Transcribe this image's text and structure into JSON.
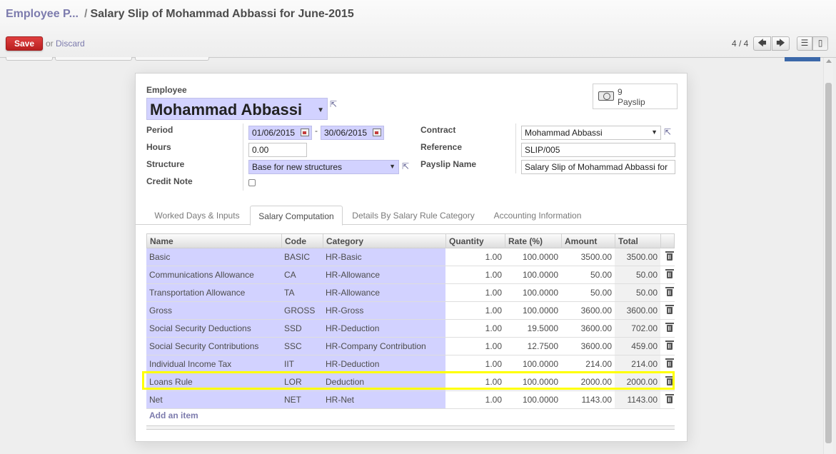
{
  "breadcrumb": {
    "parent": "Employee P...",
    "separator": "/",
    "current": "Salary Slip of Mohammad Abbassi for June-2015"
  },
  "toolbar": {
    "save_label": "Save",
    "or_text": "or",
    "discard_label": "Discard"
  },
  "pager": {
    "text": "4 / 4"
  },
  "smart_button": {
    "count": "9",
    "label": "Payslip"
  },
  "form": {
    "employee_label": "Employee",
    "employee_value": "Mohammad Abbassi",
    "period_label": "Period",
    "period_from": "01/06/2015",
    "period_separator": "-",
    "period_to": "30/06/2015",
    "hours_label": "Hours",
    "hours_value": "0.00",
    "structure_label": "Structure",
    "structure_value": "Base for new structures",
    "credit_note_label": "Credit Note",
    "credit_note_checked": false,
    "contract_label": "Contract",
    "contract_value": "Mohammad Abbassi",
    "reference_label": "Reference",
    "reference_value": "SLIP/005",
    "payslip_name_label": "Payslip Name",
    "payslip_name_value": "Salary Slip of Mohammad Abbassi for"
  },
  "tabs": [
    {
      "label": "Worked Days & Inputs",
      "active": false
    },
    {
      "label": "Salary Computation",
      "active": true
    },
    {
      "label": "Details By Salary Rule Category",
      "active": false
    },
    {
      "label": "Accounting Information",
      "active": false
    }
  ],
  "table": {
    "columns": [
      "Name",
      "Code",
      "Category",
      "Quantity",
      "Rate (%)",
      "Amount",
      "Total"
    ],
    "rows": [
      {
        "name": "Basic",
        "code": "BASIC",
        "category": "HR-Basic",
        "quantity": "1.00",
        "rate": "100.0000",
        "amount": "3500.00",
        "total": "3500.00"
      },
      {
        "name": "Communications Allowance",
        "code": "CA",
        "category": "HR-Allowance",
        "quantity": "1.00",
        "rate": "100.0000",
        "amount": "50.00",
        "total": "50.00"
      },
      {
        "name": "Transportation Allowance",
        "code": "TA",
        "category": "HR-Allowance",
        "quantity": "1.00",
        "rate": "100.0000",
        "amount": "50.00",
        "total": "50.00"
      },
      {
        "name": "Gross",
        "code": "GROSS",
        "category": "HR-Gross",
        "quantity": "1.00",
        "rate": "100.0000",
        "amount": "3600.00",
        "total": "3600.00"
      },
      {
        "name": "Social Security Deductions",
        "code": "SSD",
        "category": "HR-Deduction",
        "quantity": "1.00",
        "rate": "19.5000",
        "amount": "3600.00",
        "total": "702.00"
      },
      {
        "name": "Social Security Contributions",
        "code": "SSC",
        "category": "HR-Company Contribution",
        "quantity": "1.00",
        "rate": "12.7500",
        "amount": "3600.00",
        "total": "459.00"
      },
      {
        "name": "Individual Income Tax",
        "code": "IIT",
        "category": "HR-Deduction",
        "quantity": "1.00",
        "rate": "100.0000",
        "amount": "214.00",
        "total": "214.00"
      },
      {
        "name": "Loans Rule",
        "code": "LOR",
        "category": "Deduction",
        "quantity": "1.00",
        "rate": "100.0000",
        "amount": "2000.00",
        "total": "2000.00"
      },
      {
        "name": "Net",
        "code": "NET",
        "category": "HR-Net",
        "quantity": "1.00",
        "rate": "100.0000",
        "amount": "1143.00",
        "total": "1143.00"
      }
    ],
    "add_item_label": "Add an item"
  },
  "colors": {
    "accent": "#7c7bad",
    "save": "#d03030",
    "required_bg": "#d2d2ff",
    "highlight": "#ffff00"
  }
}
